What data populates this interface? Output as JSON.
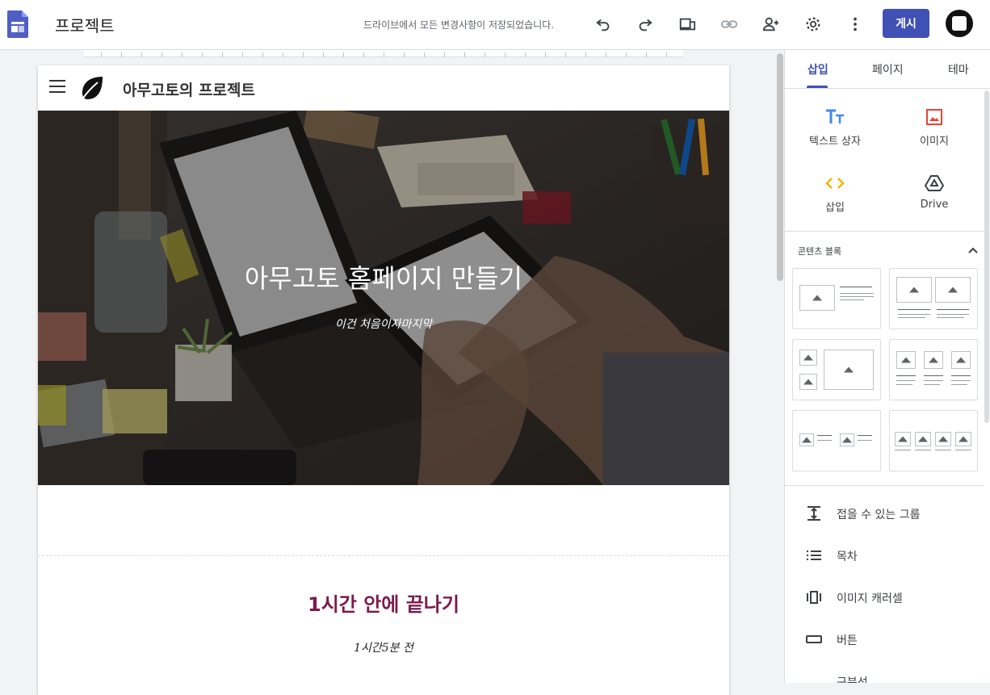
{
  "topbar": {
    "title": "프로젝트",
    "save_status": "드라이브에서 모든 변경사항이 저장되었습니다.",
    "publish_label": "게시",
    "icons": [
      "sites-logo-icon",
      "undo-icon",
      "redo-icon",
      "preview-devices-icon",
      "link-icon",
      "add-person-icon",
      "settings-gear-icon",
      "more-vert-icon",
      "avatar"
    ]
  },
  "site": {
    "name": "아무고토의 프로젝트",
    "hero_title": "아무고토 홈페이지 만들기",
    "hero_subtitle": "이건 처음이자마지막",
    "section_title": "1시간 안에 끝나기",
    "section_subtitle": "1시간5분 전"
  },
  "panel": {
    "tabs": [
      {
        "label": "삽입",
        "active": true
      },
      {
        "label": "페이지",
        "active": false
      },
      {
        "label": "테마",
        "active": false
      }
    ],
    "insert_items": [
      {
        "label": "텍스트 상자",
        "icon": "text-box-icon"
      },
      {
        "label": "이미지",
        "icon": "image-icon"
      },
      {
        "label": "삽입",
        "icon": "embed-code-icon"
      },
      {
        "label": "Drive",
        "icon": "drive-icon"
      }
    ],
    "content_blocks_title": "콘텐츠 블록",
    "list_items": [
      {
        "label": "접을 수 있는 그룹",
        "icon": "collapsible-group-icon"
      },
      {
        "label": "목차",
        "icon": "table-of-contents-icon"
      },
      {
        "label": "이미지 캐러셀",
        "icon": "image-carousel-icon"
      },
      {
        "label": "버튼",
        "icon": "button-icon"
      },
      {
        "label": "구분선",
        "icon": "divider-icon"
      }
    ]
  },
  "colors": {
    "accent": "#3f51b5",
    "section_title": "#7b1b4d",
    "text_box_icon": "#4285f4",
    "image_icon": "#ea4335",
    "embed_icon": "#f4b400"
  }
}
